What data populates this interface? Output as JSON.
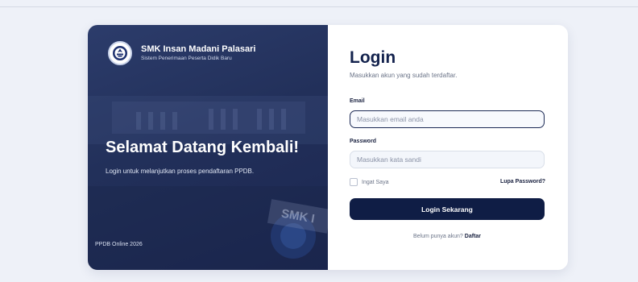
{
  "brand": {
    "school_name": "SMK Insan Madani Palasari",
    "tagline": "Sistem Penerimaan Peserta Didik Baru"
  },
  "hero": {
    "welcome": "Selamat Datang Kembali!",
    "subtitle": "Login untuk melanjutkan proses pendaftaran PPDB.",
    "footer": "PPDB Online 2026",
    "sign_text": "SMK I"
  },
  "form": {
    "title": "Login",
    "subtitle": "Masukkan akun yang sudah terdaftar.",
    "email_label": "Email",
    "email_placeholder": "Masukkan email anda",
    "password_label": "Password",
    "password_placeholder": "Masukkan kata sandi",
    "remember_label": "Ingat Saya",
    "forgot_label": "Lupa Password?",
    "submit_label": "Login Sekarang",
    "register_prompt": "Belum punya akun?",
    "register_link": "Daftar"
  },
  "colors": {
    "primary": "#0f1d45",
    "background": "#eef1f8",
    "hero_overlay": "#22305a"
  }
}
